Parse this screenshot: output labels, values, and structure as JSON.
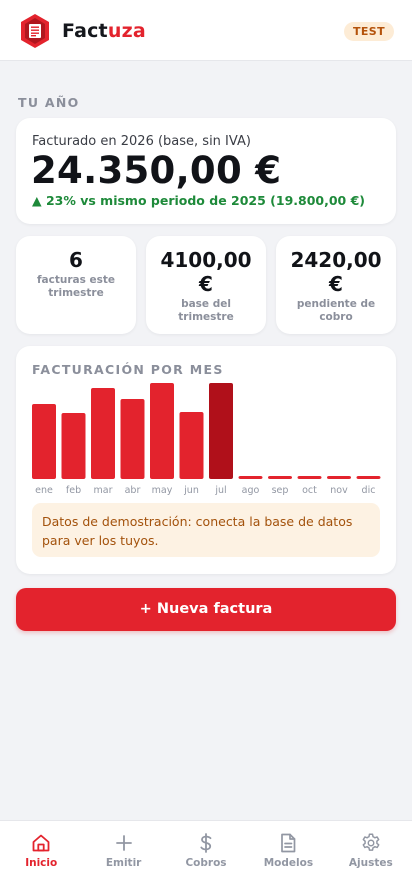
{
  "header": {
    "brand_part1": "Fact",
    "brand_part2": "uza",
    "env_badge": "TEST",
    "colors": {
      "brand": "#e3232d",
      "logo_dark": "#b0161e"
    }
  },
  "section_title": "TU AÑO",
  "year_card": {
    "label": "Facturado en 2026 (base, sin IVA)",
    "amount": "24.350,00 €",
    "comparison": "▲ 23% vs mismo periodo de 2025 (19.800,00 €)",
    "comparison_color": "#1e8a3a"
  },
  "stats": [
    {
      "value_line1": "6",
      "value_line2": "",
      "label": "facturas este trimestre"
    },
    {
      "value_line1": "4100,00",
      "value_line2": "€",
      "label": "base del trimestre"
    },
    {
      "value_line1": "2420,00",
      "value_line2": "€",
      "label": "pendiente de cobro"
    }
  ],
  "chart": {
    "title": "FACTURACIÓN POR MES",
    "notice": "Datos de demostración: conecta la base de datos para ver los tuyos."
  },
  "chart_data": {
    "type": "bar",
    "title": "FACTURACIÓN POR MES",
    "categories": [
      "ene",
      "feb",
      "mar",
      "abr",
      "may",
      "jun",
      "jul",
      "ago",
      "sep",
      "oct",
      "nov",
      "dic"
    ],
    "values": [
      3750,
      3300,
      4550,
      4000,
      4800,
      3350,
      4800,
      0,
      0,
      0,
      0,
      0
    ],
    "highlight_index": 6,
    "xlabel": "",
    "ylabel": "",
    "grid": false,
    "colors": {
      "bar": "#e3232d",
      "highlight": "#b0101a",
      "empty": "#e3232d"
    }
  },
  "cta_label": "+ Nueva factura",
  "bottom_nav": [
    {
      "label": "Inicio",
      "icon": "home-icon",
      "active": true
    },
    {
      "label": "Emitir",
      "icon": "plus-icon",
      "active": false
    },
    {
      "label": "Cobros",
      "icon": "dollar-icon",
      "active": false
    },
    {
      "label": "Modelos",
      "icon": "document-icon",
      "active": false
    },
    {
      "label": "Ajustes",
      "icon": "gear-icon",
      "active": false
    }
  ]
}
